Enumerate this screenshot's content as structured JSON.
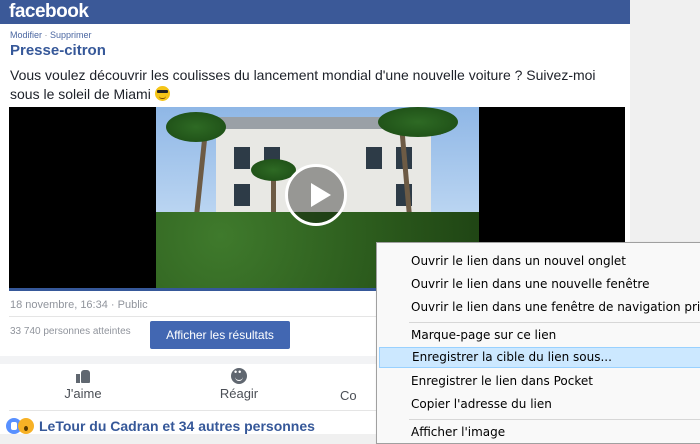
{
  "facebook": {
    "logo": "facebook",
    "post": {
      "edit_label": "Modifier",
      "separator": " · ",
      "delete_label": "Supprimer",
      "page_name": "Presse-citron",
      "text": "Vous voulez découvrir les coulisses du lancement mondial d'une nouvelle voiture ? Suivez-moi sous le soleil de Miami",
      "timestamp": "18 novembre, 16:34",
      "meta_separator": " · ",
      "audience": "Public",
      "reach": "33 740 personnes atteintes",
      "results_button": "Afficher les résultats",
      "actions": {
        "like": "J'aime",
        "react": "Réagir",
        "comment_partial": "Co"
      },
      "reactions_text": "LeTour du Cadran et 34 autres personnes"
    },
    "colors": {
      "brand": "#3b5998",
      "link": "#365899",
      "button": "#4267b2"
    }
  },
  "context_menu": {
    "items": [
      {
        "label": "Ouvrir le lien dans un nouvel onglet",
        "highlighted": false
      },
      {
        "label": "Ouvrir le lien dans une nouvelle fenêtre",
        "highlighted": false
      },
      {
        "label": "Ouvrir le lien dans une fenêtre de navigation privée",
        "highlighted": false
      },
      {
        "label": "Marque-page sur ce lien",
        "highlighted": false
      },
      {
        "label": "Enregistrer la cible du lien sous...",
        "highlighted": true
      },
      {
        "label": "Enregistrer le lien dans Pocket",
        "highlighted": false
      },
      {
        "label": "Copier l'adresse du lien",
        "highlighted": false
      },
      {
        "label": "Afficher l'image",
        "highlighted": false
      }
    ]
  }
}
